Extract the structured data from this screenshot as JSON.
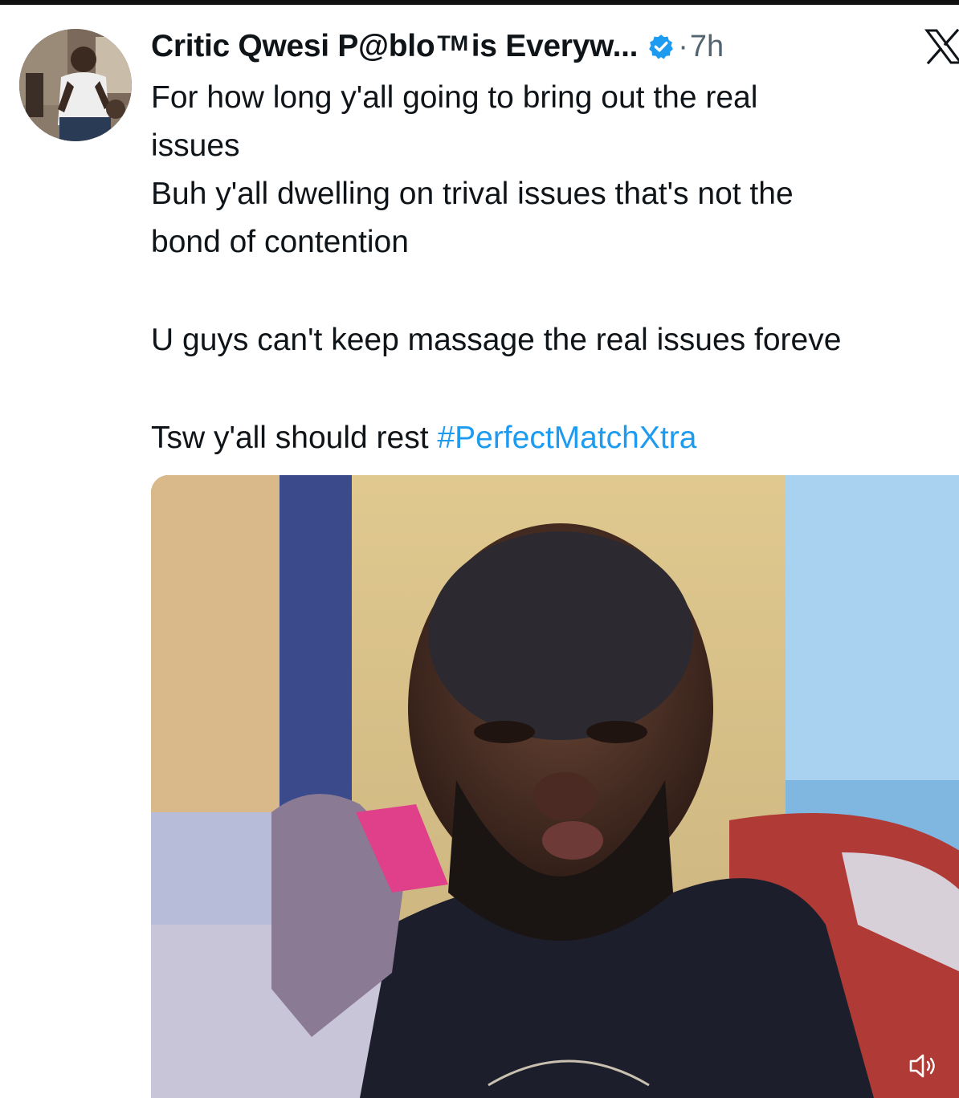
{
  "tweet": {
    "author": {
      "display_name": "Critic Qwesi P@blo",
      "trademark": "TM",
      "name_suffix": "is Everyw...",
      "verified": true
    },
    "separator": "·",
    "timestamp": "7h",
    "text_lines": [
      "For how long y'all going to bring out  the real",
      "issues",
      "Buh y'all dwelling on trival issues that's not the",
      "bond of contention",
      "",
      "U guys can't keep massage the real issues foreve",
      "",
      "Tsw y'all should rest"
    ],
    "hashtag": "#PerfectMatchXtra",
    "media": {
      "type": "video",
      "muted_icon": "volume-icon"
    }
  },
  "icons": {
    "platform_logo": "x-logo-icon",
    "verified": "verified-badge-icon",
    "volume": "volume-icon"
  },
  "colors": {
    "text": "#0f1419",
    "secondary_text": "#536471",
    "link": "#1d9bf0",
    "verified_badge": "#1d9bf0"
  }
}
